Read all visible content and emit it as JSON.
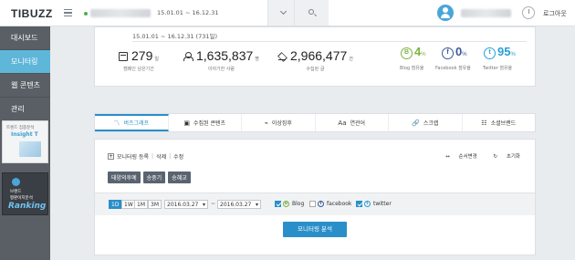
{
  "app": {
    "logo": "TIBUZZ"
  },
  "header": {
    "period": "15.01.01 ~ 16.12.31",
    "logout_label": "로그아웃"
  },
  "sidebar": {
    "items": [
      {
        "label": "대시보드"
      },
      {
        "label": "모니터링"
      },
      {
        "label": "웹 콘텐츠"
      },
      {
        "label": "관리"
      }
    ],
    "banner1": {
      "line1": "트렌드 집중분석",
      "line2": "Insight T"
    },
    "banner2": {
      "line1": "브랜드",
      "line2": "평판이지분석",
      "line3": "Ranking"
    }
  },
  "stats": {
    "period": "15.01.01 ~ 16.12.31 (731일)",
    "items": [
      {
        "value": "279",
        "unit": "일",
        "label": "캠페인 남은기간",
        "icon": "calendar-icon"
      },
      {
        "value": "1,635,837",
        "unit": "명",
        "label": "이야기한 사람",
        "icon": "people-icon"
      },
      {
        "value": "2,966,477",
        "unit": "건",
        "label": "수집된 글",
        "icon": "layers-icon"
      }
    ],
    "shares": [
      {
        "glyph": "B",
        "value": "4",
        "unit": "%",
        "label": "Blog 점유율",
        "color": "#7cb342"
      },
      {
        "glyph": "f",
        "value": "0",
        "unit": "%",
        "label": "Facebook 점유율",
        "color": "#3b5998"
      },
      {
        "glyph": "t",
        "value": "95",
        "unit": "%",
        "label": "Twitter 점유율",
        "color": "#2a9fd6"
      }
    ]
  },
  "tabs": [
    {
      "label": "버즈그래프",
      "icon": "〽"
    },
    {
      "label": "수집된 콘텐츠",
      "icon": "▣"
    },
    {
      "label": "이상징후",
      "icon": "⌁"
    },
    {
      "label": "연관어",
      "icon": "Aa"
    },
    {
      "label": "스크랩",
      "icon": "🔗"
    },
    {
      "label": "소셜브랜드",
      "icon": "☷"
    }
  ],
  "panel": {
    "register_label": "모니터링 등록",
    "delete_label": "삭제",
    "edit_label": "수정",
    "reorder_label": "순서변경",
    "reset_label": "초기화",
    "keywords": [
      "태양의후예",
      "송중기",
      "송혜교"
    ],
    "periods": [
      "1D",
      "1W",
      "1M",
      "3M"
    ],
    "date_from": "2016.03.27",
    "date_to": "2016.03.27",
    "tilde": "~",
    "sources": [
      {
        "label": "Blog",
        "checked": true,
        "glyph": "B",
        "color": "#7cb342"
      },
      {
        "label": "facebook",
        "checked": false,
        "glyph": "f",
        "color": "#3b5998"
      },
      {
        "label": "twitter",
        "checked": true,
        "glyph": "t",
        "color": "#2a9fd6"
      }
    ],
    "analyze_label": "모니터링 분석"
  },
  "colors": {
    "accent": "#2a8fc9",
    "sidebar": "#5a5f65",
    "sidebar_active": "#5eb6d8"
  }
}
